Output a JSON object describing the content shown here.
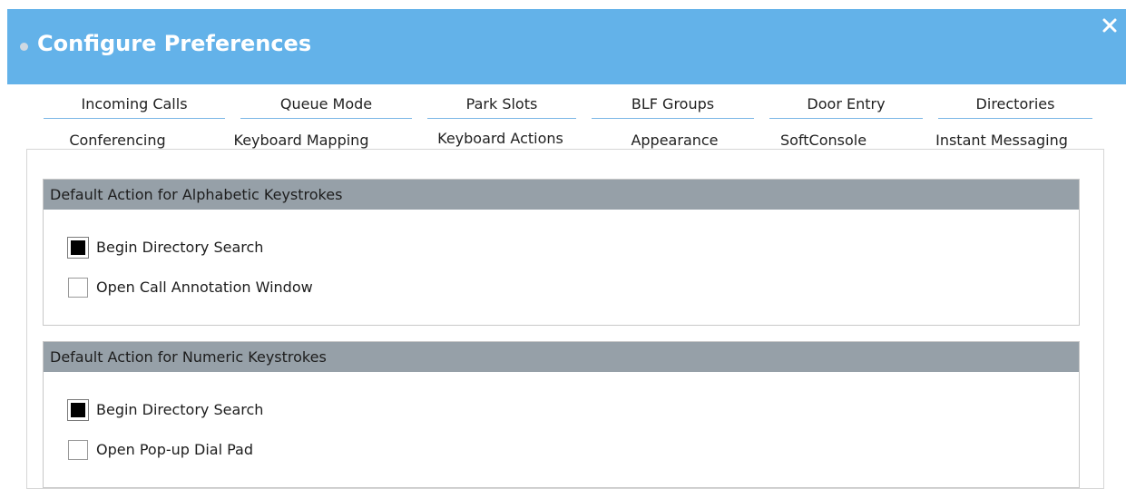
{
  "window": {
    "title": "Configure Preferences"
  },
  "tabs": {
    "row1": [
      "Incoming Calls",
      "Queue Mode",
      "Park Slots",
      "BLF Groups",
      "Door Entry",
      "Directories"
    ],
    "row2": [
      "Conferencing",
      "Keyboard Mapping",
      "Keyboard Actions",
      "Appearance",
      "SoftConsole",
      "Instant Messaging"
    ],
    "active": "Keyboard Actions"
  },
  "alphabetic": {
    "header": "Default Action for Alphabetic Keystrokes",
    "options": [
      {
        "label": "Begin Directory Search",
        "checked": true
      },
      {
        "label": "Open Call Annotation Window",
        "checked": false
      }
    ]
  },
  "numeric": {
    "header": "Default Action for Numeric Keystrokes",
    "options": [
      {
        "label": "Begin Directory Search",
        "checked": true
      },
      {
        "label": "Open Pop-up Dial Pad",
        "checked": false
      }
    ]
  },
  "colors": {
    "titlebar": "#63b2e9",
    "tab_underline": "#7ab7e6",
    "tab_active": "#1f8ee8",
    "group_header": "#96a0a8"
  }
}
